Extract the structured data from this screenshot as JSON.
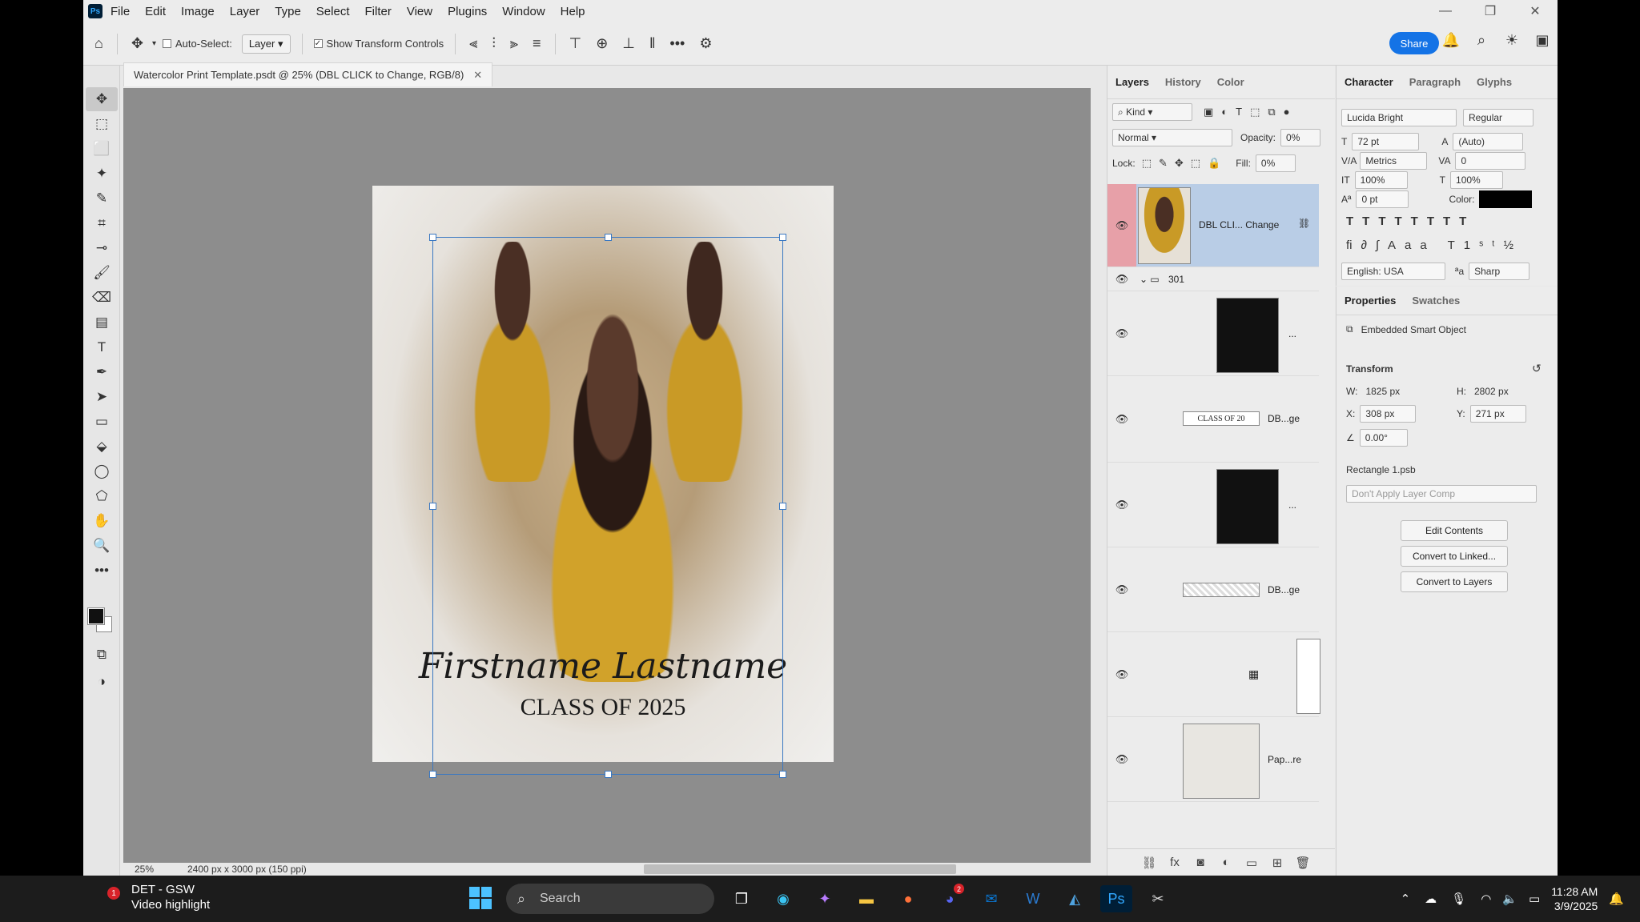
{
  "menu": [
    "File",
    "Edit",
    "Image",
    "Layer",
    "Type",
    "Select",
    "Filter",
    "View",
    "Plugins",
    "Window",
    "Help"
  ],
  "options": {
    "auto_select_label": "Auto-Select:",
    "auto_select_value": "Layer",
    "transform_label": "Show Transform Controls",
    "share_label": "Share"
  },
  "document": {
    "tab_title": "Watercolor Print Template.psdt @ 25% (DBL CLICK to Change, RGB/8)",
    "name_text": "Firstname Lastname",
    "class_text": "CLASS OF 2025",
    "zoom": "25%",
    "doc_size": "2400 px x 3000 px (150 ppi)"
  },
  "layers_panel": {
    "tabs": [
      "Layers",
      "History",
      "Color"
    ],
    "kind_label": "Kind",
    "blend_mode": "Normal",
    "opacity_label": "Opacity:",
    "opacity_value": "0%",
    "lock_label": "Lock:",
    "fill_label": "Fill:",
    "fill_value": "0%",
    "layers": [
      {
        "name": "DBL CLI... Change"
      },
      {
        "name": "301"
      },
      {
        "name": "..."
      },
      {
        "name": "DB...ge",
        "thumb_text": "CLASS OF 20"
      },
      {
        "name": "..."
      },
      {
        "name": "DB...ge"
      },
      {
        "name": ""
      },
      {
        "name": "Pap...re"
      }
    ]
  },
  "character_panel": {
    "tabs": [
      "Character",
      "Paragraph",
      "Glyphs"
    ],
    "font_family": "Lucida Bright",
    "font_style": "Regular",
    "font_size": "72 pt",
    "leading": "(Auto)",
    "kerning": "Metrics",
    "tracking": "0",
    "vertical_scale": "100%",
    "horizontal_scale": "100%",
    "baseline_shift": "0 pt",
    "color_label": "Color:",
    "language": "English: USA",
    "antialias": "Sharp"
  },
  "properties_panel": {
    "tabs": [
      "Properties",
      "Swatches"
    ],
    "object_type": "Embedded Smart Object",
    "transform_label": "Transform",
    "w_label": "W:",
    "w_value": "1825 px",
    "h_label": "H:",
    "h_value": "2802 px",
    "x_label": "X:",
    "x_value": "308 px",
    "y_label": "Y:",
    "y_value": "271 px",
    "angle": "0.00°",
    "linked_file": "Rectangle 1.psb",
    "layer_comp": "Don't Apply Layer Comp",
    "edit_contents": "Edit Contents",
    "convert_linked": "Convert to Linked...",
    "convert_layers": "Convert to Layers"
  },
  "taskbar": {
    "news_title": "DET - GSW",
    "news_sub": "Video highlight",
    "news_badge": "1",
    "search_placeholder": "Search",
    "time": "11:28 AM",
    "date": "3/9/2025",
    "discord_badge": "2"
  }
}
